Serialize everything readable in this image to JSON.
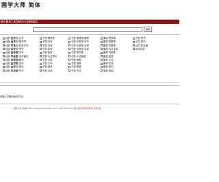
{
  "header": {
    "logo_text": "国学大师 简体"
  },
  "nav": {
    "items": [
      "首页",
      "常用工具",
      "我的中文",
      "搜索建议"
    ]
  },
  "search": {
    "button_label": "搜索",
    "value": ""
  },
  "categories": [
    "经部·易类",
    "史部·正史",
    "子部·儒家类",
    "子部·谱录类·器物",
    "集部·楚辞类",
    "子部·类书",
    "经部·书类",
    "史部·编年类",
    "子部·兵家",
    "子部·杂家类·杂学",
    "集部·别集类",
    "丛书·类书",
    "经部·诗类",
    "史部·纪事本末",
    "子部·法家",
    "子部·杂家类·杂考",
    "集部·总集类",
    "丛书·类丛编",
    "经部·礼类",
    "史部·别史",
    "子部·农家",
    "子部·杂家类·杂说",
    "集部·诗文评类",
    "综合杂类",
    "经部·春秋类",
    "史部·杂史",
    "子部·医家",
    "子部·类书类",
    "集部·词曲类",
    "",
    "经部·孝经类",
    "史部·诏令奏议",
    "子部·天文算法",
    "子部·小说家类",
    "集部·曲类",
    "",
    "经部·五经总义",
    "史部·传记",
    "子部·术数",
    "子部·释家",
    "集部·小说",
    "",
    "经部·四书类",
    "史部·史钞",
    "子部·艺术",
    "子部·道家",
    "集部·志怪",
    "",
    "经部·乐类",
    "史部·载记",
    "子部·谱录",
    "子部·医家",
    "集部·笔记",
    "",
    "经部·小学类",
    "史部·时令",
    "子部·杂家",
    "子部·天文",
    "集部·戏曲",
    ""
  ],
  "prompt": {
    "text": "请输入您要检索的内容"
  },
  "footer": {
    "text": "国学大师 简体版 http://www.guoxuedashi.net  © 2011-2020  沪ICP备",
    "links": "免责声明 联系我们 意见反馈"
  }
}
